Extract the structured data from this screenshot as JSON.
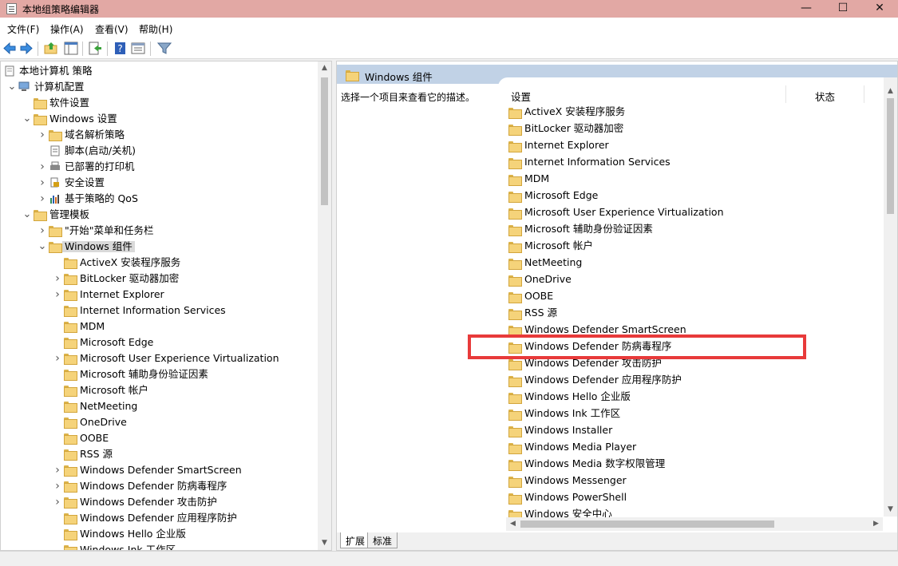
{
  "window": {
    "title": "本地组策略编辑器",
    "controls": {
      "minimize": "—",
      "maximize": "☐",
      "close": "✕"
    }
  },
  "menubar": {
    "items": [
      {
        "label": "文件(F)"
      },
      {
        "label": "操作(A)"
      },
      {
        "label": "查看(V)"
      },
      {
        "label": "帮助(H)"
      }
    ]
  },
  "toolbar": {
    "buttons": [
      {
        "icon": "back-arrow-icon"
      },
      {
        "icon": "forward-arrow-icon"
      },
      {
        "icon": "up-folder-icon"
      },
      {
        "icon": "show-hide-tree-icon"
      },
      {
        "icon": "export-list-icon"
      },
      {
        "icon": "help-icon"
      },
      {
        "icon": "properties-icon"
      },
      {
        "icon": "filter-icon"
      }
    ]
  },
  "tree": {
    "items": [
      {
        "label": "本地计算机 策略",
        "icon": "policy-doc-icon",
        "expander": ""
      },
      {
        "label": "计算机配置",
        "icon": "computer-icon",
        "expander": "expanded"
      },
      {
        "label": "软件设置",
        "icon": "folder-icon",
        "expander": ""
      },
      {
        "label": "Windows 设置",
        "icon": "folder-icon",
        "expander": "expanded"
      },
      {
        "label": "域名解析策略",
        "icon": "folder-icon",
        "expander": "collapsed"
      },
      {
        "label": "脚本(启动/关机)",
        "icon": "script-icon",
        "expander": ""
      },
      {
        "label": "已部署的打印机",
        "icon": "printer-icon",
        "expander": "collapsed"
      },
      {
        "label": "安全设置",
        "icon": "security-icon",
        "expander": "collapsed"
      },
      {
        "label": "基于策略的 QoS",
        "icon": "qos-chart-icon",
        "expander": "collapsed"
      },
      {
        "label": "管理模板",
        "icon": "folder-icon",
        "expander": "expanded"
      },
      {
        "label": "\"开始\"菜单和任务栏",
        "icon": "folder-icon",
        "expander": "collapsed"
      },
      {
        "label": "Windows 组件",
        "icon": "folder-open-icon",
        "expander": "expanded",
        "selected": true
      },
      {
        "label": "ActiveX 安装程序服务",
        "icon": "folder-icon",
        "expander": ""
      },
      {
        "label": "BitLocker 驱动器加密",
        "icon": "folder-icon",
        "expander": "collapsed"
      },
      {
        "label": "Internet Explorer",
        "icon": "folder-icon",
        "expander": "collapsed"
      },
      {
        "label": "Internet Information Services",
        "icon": "folder-icon",
        "expander": ""
      },
      {
        "label": "MDM",
        "icon": "folder-icon",
        "expander": ""
      },
      {
        "label": "Microsoft Edge",
        "icon": "folder-icon",
        "expander": ""
      },
      {
        "label": "Microsoft User Experience Virtualization",
        "icon": "folder-icon",
        "expander": "collapsed"
      },
      {
        "label": "Microsoft 辅助身份验证因素",
        "icon": "folder-icon",
        "expander": ""
      },
      {
        "label": "Microsoft 帐户",
        "icon": "folder-icon",
        "expander": ""
      },
      {
        "label": "NetMeeting",
        "icon": "folder-icon",
        "expander": ""
      },
      {
        "label": "OneDrive",
        "icon": "folder-icon",
        "expander": ""
      },
      {
        "label": "OOBE",
        "icon": "folder-icon",
        "expander": ""
      },
      {
        "label": "RSS 源",
        "icon": "folder-icon",
        "expander": ""
      },
      {
        "label": "Windows Defender SmartScreen",
        "icon": "folder-icon",
        "expander": "collapsed"
      },
      {
        "label": "Windows Defender 防病毒程序",
        "icon": "folder-icon",
        "expander": "collapsed"
      },
      {
        "label": "Windows Defender 攻击防护",
        "icon": "folder-icon",
        "expander": "collapsed"
      },
      {
        "label": "Windows Defender 应用程序防护",
        "icon": "folder-icon",
        "expander": ""
      },
      {
        "label": "Windows Hello 企业版",
        "icon": "folder-icon",
        "expander": ""
      },
      {
        "label": "Windows Ink 工作区",
        "icon": "folder-icon",
        "expander": ""
      }
    ]
  },
  "detail": {
    "header_title": "Windows 组件",
    "description": "选择一个项目来查看它的描述。",
    "columns": {
      "setting": "设置",
      "state": "状态"
    },
    "items": [
      {
        "label": "ActiveX 安装程序服务"
      },
      {
        "label": "BitLocker 驱动器加密"
      },
      {
        "label": "Internet Explorer"
      },
      {
        "label": "Internet Information Services"
      },
      {
        "label": "MDM"
      },
      {
        "label": "Microsoft Edge"
      },
      {
        "label": "Microsoft User Experience Virtualization"
      },
      {
        "label": "Microsoft 辅助身份验证因素"
      },
      {
        "label": "Microsoft 帐户"
      },
      {
        "label": "NetMeeting"
      },
      {
        "label": "OneDrive"
      },
      {
        "label": "OOBE"
      },
      {
        "label": "RSS 源"
      },
      {
        "label": "Windows Defender SmartScreen"
      },
      {
        "label": "Windows Defender 防病毒程序",
        "highlighted": true
      },
      {
        "label": "Windows Defender 攻击防护"
      },
      {
        "label": "Windows Defender 应用程序防护"
      },
      {
        "label": "Windows Hello 企业版"
      },
      {
        "label": "Windows Ink 工作区"
      },
      {
        "label": "Windows Installer"
      },
      {
        "label": "Windows Media Player"
      },
      {
        "label": "Windows Media 数字权限管理"
      },
      {
        "label": "Windows Messenger"
      },
      {
        "label": "Windows PowerShell"
      },
      {
        "label": "Windows 安全中心"
      }
    ],
    "tabs": [
      {
        "label": "扩展",
        "active": true
      },
      {
        "label": "标准",
        "active": false
      }
    ]
  },
  "colors": {
    "titlebar": "#e2a8a4",
    "header_band": "#c1d2e6",
    "highlight_border": "#e83a3a",
    "folder_fill": "#f5d37a"
  }
}
